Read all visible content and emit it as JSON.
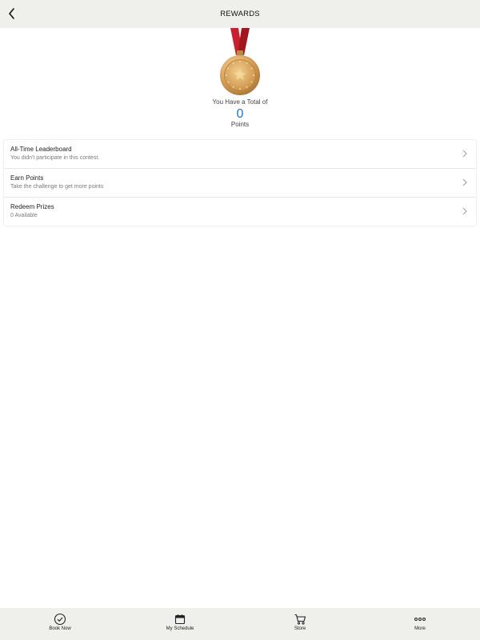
{
  "header": {
    "title": "REWARDS"
  },
  "summary": {
    "total_label": "You Have a Total of",
    "points_value": "0",
    "points_label": "Points"
  },
  "menu": {
    "items": [
      {
        "title": "All-Time Leaderboard",
        "subtitle": "You didn't participate in this contest."
      },
      {
        "title": "Earn Points",
        "subtitle": "Take the challenge to get more points"
      },
      {
        "title": "Redeem Prizes",
        "subtitle": "0 Available"
      }
    ]
  },
  "tabs": [
    {
      "label": "Book Now",
      "icon": "check-circle-icon"
    },
    {
      "label": "My Schedule",
      "icon": "calendar-icon"
    },
    {
      "label": "Store",
      "icon": "cart-icon"
    },
    {
      "label": "More",
      "icon": "more-dots-icon"
    }
  ],
  "colors": {
    "accent": "#1b78c8",
    "bar_background": "#efefec",
    "ribbon": "#c8202e",
    "medal_gold": "#d9a45b"
  }
}
